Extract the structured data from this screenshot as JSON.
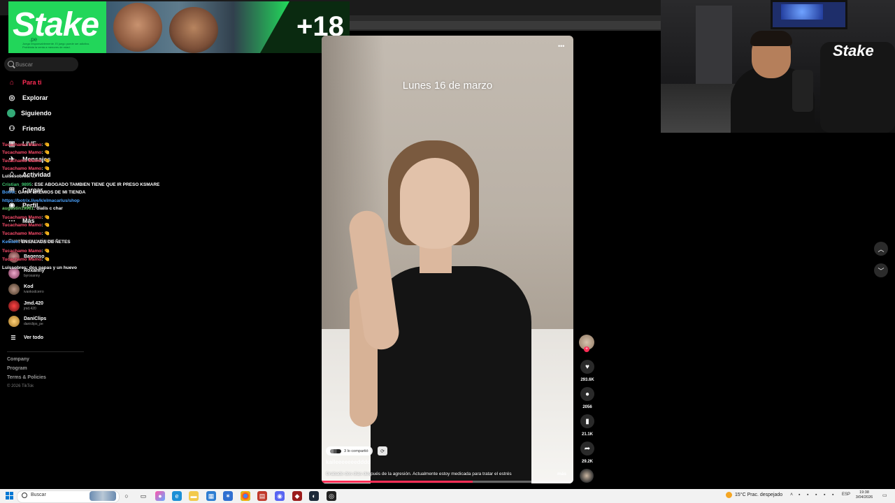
{
  "banner": {
    "logo": "Stake",
    "sub": ".pe",
    "age": "+18",
    "fineprint": "Juega responsablemente. El juego puede ser adictivo. Prohibida la venta a menores de edad."
  },
  "sidebar": {
    "search_placeholder": "Buscar",
    "nav": [
      {
        "label": "Para ti",
        "icon": "home-icon"
      },
      {
        "label": "Explorar",
        "icon": "compass-icon"
      },
      {
        "label": "Siguiendo",
        "icon": "following-icon"
      },
      {
        "label": "Friends",
        "icon": "friends-icon"
      },
      {
        "label": "LIVE",
        "icon": "live-icon"
      },
      {
        "label": "Mensajes",
        "icon": "message-icon"
      },
      {
        "label": "Actividad",
        "icon": "activity-icon"
      },
      {
        "label": "Cargar",
        "icon": "upload-icon"
      },
      {
        "label": "Perfil",
        "icon": "profile-icon"
      },
      {
        "label": "Más",
        "icon": "more-icon"
      }
    ],
    "following_title": "Cuentas que sigues",
    "following": [
      {
        "name": "Bagenso",
        "handle": ""
      },
      {
        "name": "Roxanny",
        "handle": "byroxanny"
      },
      {
        "name": "Kod",
        "handle": "ivankodcerro"
      },
      {
        "name": "Jmd.420",
        "handle": "jmd.420"
      },
      {
        "name": "DaniClips",
        "handle": "daniclips_pe"
      }
    ],
    "see_all": "Ver todo",
    "footer_links": [
      "Company",
      "Program",
      "Terms & Policies"
    ],
    "copyright": "© 2026 TikTok"
  },
  "chat": [
    {
      "user": "Tucachamo Mamo",
      "msg": ": 🤏",
      "color": "#ff4d6d"
    },
    {
      "user": "Tucachamo Mamo",
      "msg": ": 🤏",
      "color": "#ff4d6d"
    },
    {
      "user": "Tucachamo Mamo",
      "msg": ": 🤏",
      "color": "#ff4d6d"
    },
    {
      "user": "Tucachamo Mamo",
      "msg": ": 🤏",
      "color": "#ff4d6d"
    },
    {
      "user": "Luisssobres",
      "msg": ": ...",
      "color": "#ffffff"
    },
    {
      "user": "Cristian_9895",
      "msg": ": ESE ABOGADO TAMBIEN TIENE QUE IR PRESO KSMARE",
      "color": "#3ec46d"
    },
    {
      "user": "Botrix",
      "msg": ": GANA PREMIOS DE MI TIENDA",
      "color": "#4aa3ff"
    },
    {
      "user": "https://botrix.live/k/elmacarlus/shop",
      "msg": "",
      "color": "#4aa3ff"
    },
    {
      "user": "augustin19961",
      "msg": ": dialis c char",
      "color": "#6fd36f"
    },
    {
      "user": "Tucachamo Mamo",
      "msg": ": 🤏",
      "color": "#ff4d6d"
    },
    {
      "user": "Tucachamo Mamo",
      "msg": ": 🤏",
      "color": "#ff4d6d"
    },
    {
      "user": "Tucachamo Mamo",
      "msg": ": 🤏",
      "color": "#ff4d6d"
    },
    {
      "user": "Kevilon",
      "msg": ": ENSALADA DE ÑETES",
      "color": "#4aa3ff"
    },
    {
      "user": "Tucachamo Mamo",
      "msg": ": 🤏",
      "color": "#ff4d6d"
    },
    {
      "user": "Tucachamo Mamo",
      "msg": ": 🤏",
      "color": "#ff4d6d"
    },
    {
      "user": "Luissobres",
      "msg": ": dos papas y un huevo",
      "color": "#ffffff"
    }
  ],
  "video": {
    "date_text": "Lunes 16 de marzo",
    "shared_text": "3 lo compartió",
    "author": "kaileeeeeeedddd",
    "caption": "Grabado dos días después de la agresión. Actualmente estoy medicada para tratar el estrés",
    "more": "más",
    "progress": 0.6
  },
  "rail": {
    "likes": "293.6K",
    "comments": "2056",
    "saves": "21.1K",
    "shares": "29.2K"
  },
  "webcam": {
    "overlay_logo": "Stake"
  },
  "taskbar": {
    "search_placeholder": "Buscar",
    "weather": "15°C  Prac. despejado",
    "lang": "ESP",
    "time": "19:38",
    "date": "3/04/2026"
  }
}
